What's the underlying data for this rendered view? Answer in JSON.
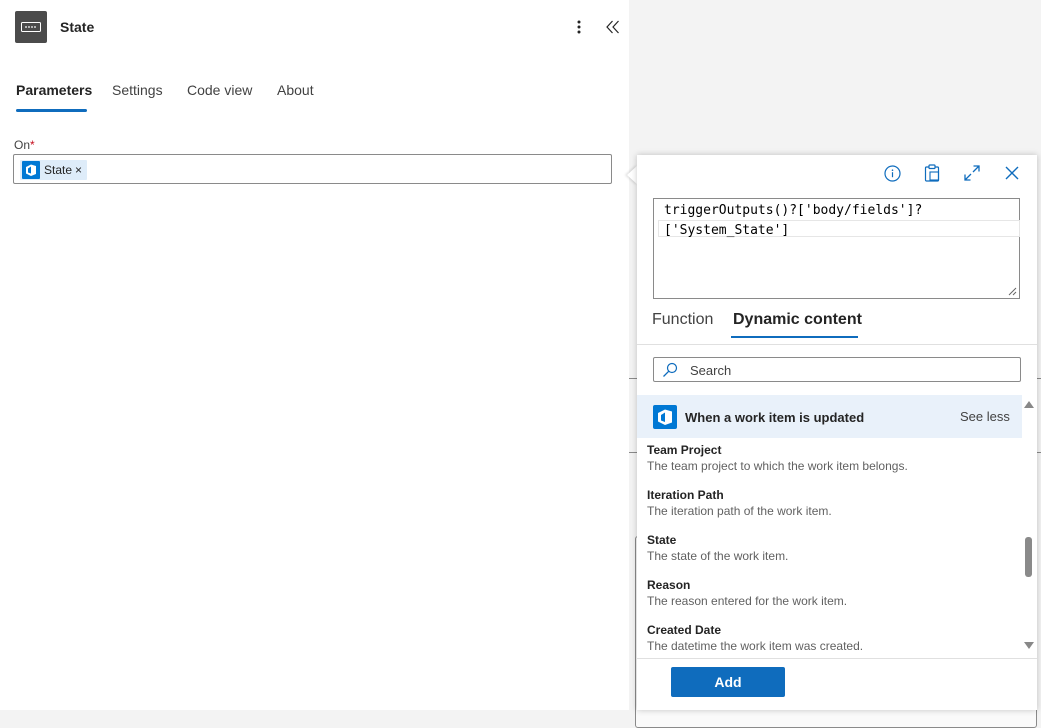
{
  "panel": {
    "title": "State",
    "tabs": [
      {
        "label": "Parameters",
        "active": true
      },
      {
        "label": "Settings",
        "active": false
      },
      {
        "label": "Code view",
        "active": false
      },
      {
        "label": "About",
        "active": false
      }
    ],
    "on_field": {
      "label": "On",
      "required_mark": "*",
      "token_label": "State",
      "token_remove": "×"
    }
  },
  "popup": {
    "expression_lines": [
      "triggerOutputs()?['body/fields']?",
      "['System_State']"
    ],
    "tabs": [
      {
        "label": "Function",
        "active": false
      },
      {
        "label": "Dynamic content",
        "active": true
      }
    ],
    "search": {
      "placeholder": "Search",
      "value": ""
    },
    "group": {
      "title": "When a work item is updated",
      "toggle": "See less"
    },
    "items": [
      {
        "title": "Team Project",
        "description": "The team project to which the work item belongs."
      },
      {
        "title": "Iteration Path",
        "description": "The iteration path of the work item."
      },
      {
        "title": "State",
        "description": "The state of the work item."
      },
      {
        "title": "Reason",
        "description": "The reason entered for the work item."
      },
      {
        "title": "Created Date",
        "description": "The datetime the work item was created."
      }
    ],
    "add_label": "Add"
  },
  "colors": {
    "accent": "#0f6cbd",
    "connector_icon_bg": "#4b4b4b",
    "devops_blue": "#0078d4",
    "group_header_bg": "#e9f1fa",
    "token_bg": "#deecf9",
    "required": "#c50f1f"
  },
  "icons": {
    "connector": "textbox-icon",
    "more": "more-vertical-icon",
    "collapse": "double-chevron-left-icon",
    "info": "info-icon",
    "clipboard": "clipboard-icon",
    "expand": "expand-icon",
    "close": "close-icon",
    "search": "search-icon",
    "devops": "azure-devops-icon"
  }
}
